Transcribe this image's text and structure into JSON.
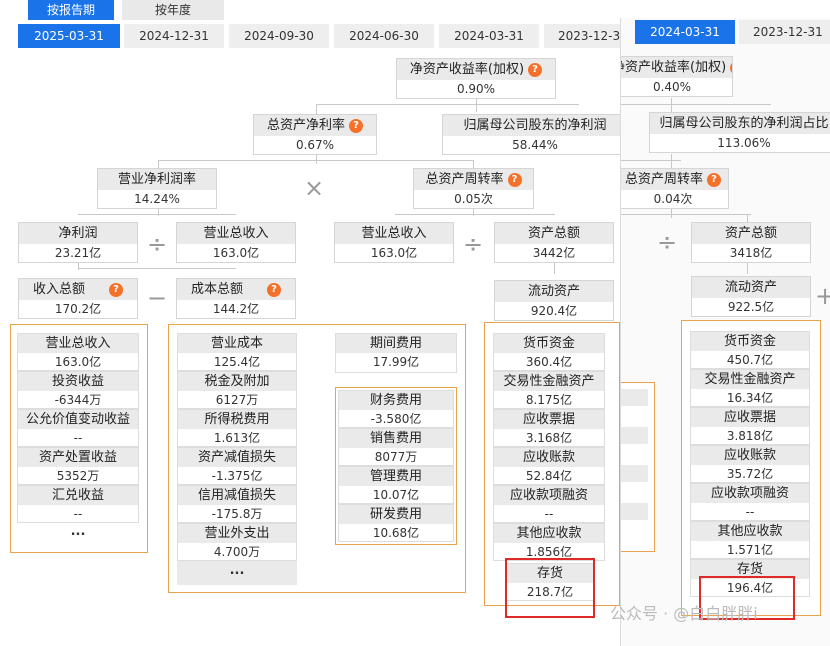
{
  "period_tabs": [
    "按报告期",
    "按年度"
  ],
  "dates": [
    "2025-03-31",
    "2024-12-31",
    "2024-09-30",
    "2024-06-30",
    "2024-03-31",
    "2023-12-31"
  ],
  "right_dates": [
    "2024-03-31",
    "2023-12-31"
  ],
  "main": {
    "roe": {
      "label": "净资产收益率(加权)",
      "value": "0.90%"
    },
    "roa": {
      "label": "总资产净利率",
      "value": "0.67%"
    },
    "parent_np": {
      "label": "归属母公司股东的净利润",
      "value": "58.44%"
    },
    "npm": {
      "label": "营业净利润率",
      "value": "14.24%"
    },
    "tat": {
      "label": "总资产周转率",
      "value": "0.05次"
    },
    "np": {
      "label": "净利润",
      "value": "23.21亿"
    },
    "rev1": {
      "label": "营业总收入",
      "value": "163.0亿"
    },
    "rev2": {
      "label": "营业总收入",
      "value": "163.0亿"
    },
    "ta": {
      "label": "资产总额",
      "value": "3442亿"
    },
    "tinc": {
      "label": "收入总额",
      "value": "170.2亿"
    },
    "tcost": {
      "label": "成本总额",
      "value": "144.2亿"
    },
    "ca": {
      "label": "流动资产",
      "value": "920.4亿"
    },
    "income_items": [
      {
        "label": "营业总收入",
        "value": "163.0亿"
      },
      {
        "label": "投资收益",
        "value": "-6344万"
      },
      {
        "label": "公允价值变动收益",
        "value": "--"
      },
      {
        "label": "资产处置收益",
        "value": "5352万"
      },
      {
        "label": "汇兑收益",
        "value": "--"
      }
    ],
    "cost_items": [
      {
        "label": "营业成本",
        "value": "125.4亿"
      },
      {
        "label": "税金及附加",
        "value": "6127万"
      },
      {
        "label": "所得税费用",
        "value": "1.613亿"
      },
      {
        "label": "资产减值损失",
        "value": "-1.375亿"
      },
      {
        "label": "信用减值损失",
        "value": "-175.8万"
      },
      {
        "label": "营业外支出",
        "value": "4.700万"
      }
    ],
    "period_exp": {
      "label": "期间费用",
      "value": "17.99亿"
    },
    "exp_items": [
      {
        "label": "财务费用",
        "value": "-3.580亿"
      },
      {
        "label": "销售费用",
        "value": "8077万"
      },
      {
        "label": "管理费用",
        "value": "10.07亿"
      },
      {
        "label": "研发费用",
        "value": "10.68亿"
      }
    ],
    "ca_items": [
      {
        "label": "货币资金",
        "value": "360.4亿"
      },
      {
        "label": "交易性金融资产",
        "value": "8.175亿"
      },
      {
        "label": "应收票据",
        "value": "3.168亿"
      },
      {
        "label": "应收账款",
        "value": "52.84亿"
      },
      {
        "label": "应收款项融资",
        "value": "--"
      },
      {
        "label": "其他应收款",
        "value": "1.856亿"
      },
      {
        "label": "存货",
        "value": "218.7亿"
      }
    ]
  },
  "right": {
    "roe": {
      "label": "净资产收益率(加权)",
      "value": "0.40%"
    },
    "parent_np": {
      "label": "归属母公司股东的净利润占比",
      "value": "113.06%"
    },
    "tat": {
      "label": "总资产周转率",
      "value": "0.04次"
    },
    "ta": {
      "label": "资产总额",
      "value": "3418亿"
    },
    "ca": {
      "label": "流动资产",
      "value": "922.5亿"
    },
    "ca_items": [
      {
        "label": "货币资金",
        "value": "450.7亿"
      },
      {
        "label": "交易性金融资产",
        "value": "16.34亿"
      },
      {
        "label": "应收票据",
        "value": "3.818亿"
      },
      {
        "label": "应收账款",
        "value": "35.72亿"
      },
      {
        "label": "应收款项融资",
        "value": "--"
      },
      {
        "label": "其他应收款",
        "value": "1.571亿"
      },
      {
        "label": "存货",
        "value": "196.4亿"
      }
    ]
  },
  "ops": {
    "times": "×",
    "divide": "÷",
    "minus": "−",
    "plus": "+"
  },
  "more": "...",
  "question_mark": "?",
  "watermark": "公众号 · @白白胖胖i"
}
